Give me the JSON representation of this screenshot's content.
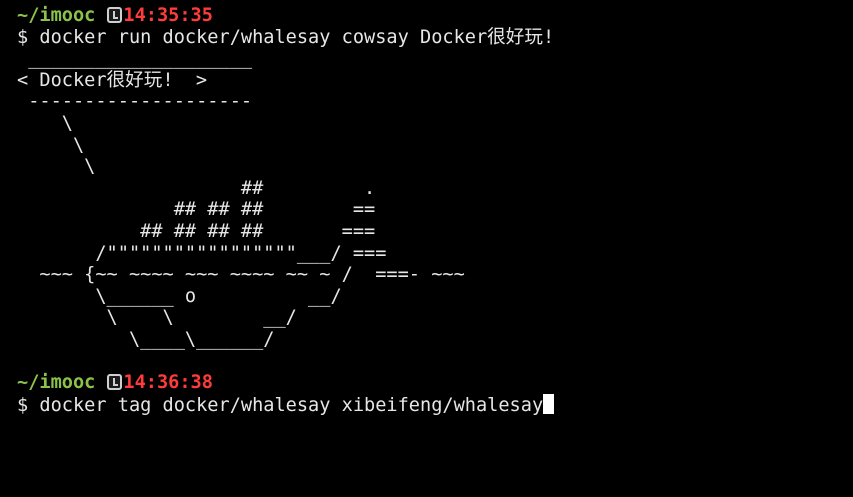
{
  "session1": {
    "user": "~/imooc",
    "time": "14:35:35",
    "command": "$ docker run docker/whalesay cowsay Docker很好玩!"
  },
  "output": [
    " ____________________ ",
    "< Docker很好玩!  >",
    " -------------------- ",
    "    \\",
    "     \\",
    "      \\",
    "                    ##         .",
    "              ## ## ##        ==",
    "           ## ## ## ##       ===",
    "       /\"\"\"\"\"\"\"\"\"\"\"\"\"\"\"\"\"___/ ===",
    "  ~~~ {~~ ~~~~ ~~~ ~~~~ ~~ ~ /  ===- ~~~",
    "       \\______ o          __/",
    "        \\    \\        __/",
    "          \\____\\______/"
  ],
  "session2": {
    "user": "~/imooc",
    "time": "14:36:38",
    "command": "$ docker tag docker/whalesay xibeifeng/whalesay"
  },
  "icons": {
    "prompt_icon": "clock-icon",
    "cursor": "block-cursor"
  },
  "colors": {
    "background": "#000000",
    "text": "#e6e6e6",
    "prompt_user": "#8bc34a",
    "prompt_time": "#ff3b3b"
  }
}
